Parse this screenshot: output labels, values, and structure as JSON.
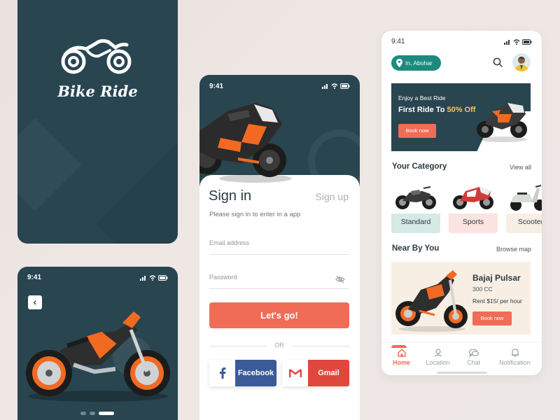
{
  "colors": {
    "dark": "#284550",
    "accent": "#f16c56",
    "teal": "#1e8a7e",
    "highlight": "#f5c76a",
    "facebook": "#3b5a9a",
    "gmail": "#e0473c"
  },
  "splash": {
    "brand": "Bike Ride",
    "logo_icon": "motorbike-icon"
  },
  "onboarding": {
    "time": "9:41",
    "back_icon": "chevron-left-icon",
    "pages": 3,
    "active_page": 3
  },
  "signin": {
    "time": "9:41",
    "title": "Sign in",
    "alt_link": "Sign up",
    "subtitle": "Please sign in to enter in a app",
    "email_placeholder": "Email address",
    "password_placeholder": "Password",
    "submit": "Let's go!",
    "divider": "OR",
    "facebook": "Facebook",
    "gmail": "Gmail"
  },
  "home": {
    "time": "9:41",
    "location": "In, Abohar",
    "banner": {
      "line1": "Enjoy a Best Ride",
      "line2_prefix": "First Ride To ",
      "line2_highlight": "50% Off",
      "button": "Book now"
    },
    "category": {
      "title": "Your Category",
      "link": "View all",
      "items": [
        {
          "label": "Standard",
          "bg": "#d5e9e6"
        },
        {
          "label": "Sports",
          "bg": "#fbe4df"
        },
        {
          "label": "Scooter",
          "bg": "#f8efe4"
        }
      ]
    },
    "nearby": {
      "title": "Near By You",
      "link": "Browse map",
      "name": "Bajaj Pulsar",
      "cc": "300 CC",
      "rent": "Rent $15/ per hour",
      "button": "Book now"
    },
    "tabs": [
      {
        "label": "Home",
        "icon": "home-icon",
        "active": true
      },
      {
        "label": "Location",
        "icon": "location-icon",
        "active": false
      },
      {
        "label": "Chat",
        "icon": "chat-icon",
        "active": false
      },
      {
        "label": "Notification",
        "icon": "bell-icon",
        "active": false
      }
    ]
  }
}
